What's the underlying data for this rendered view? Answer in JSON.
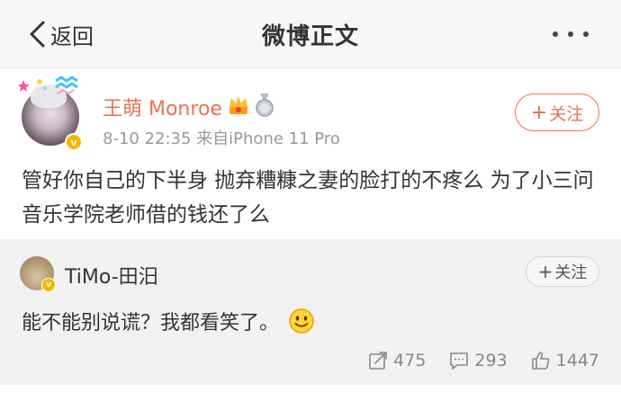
{
  "navbar": {
    "back_label": "返回",
    "title": "微博正文"
  },
  "post": {
    "author": "王萌 Monroe",
    "meta": "8-10 22:35  来自iPhone 11 Pro",
    "follow_label": "关注",
    "text": "管好你自己的下半身 抛弃糟糠之妻的脸打的不疼么  为了小三问音乐学院老师借的钱还了么"
  },
  "repost": {
    "author": "TiMo-田汨",
    "follow_label": "关注",
    "text": "能不能别说谎？我都看笑了。",
    "stats": {
      "reposts": "475",
      "comments": "293",
      "likes": "1447"
    }
  },
  "colors": {
    "accent": "#eb7350",
    "verified": "#f7b500"
  },
  "icons": [
    "back-chevron-icon",
    "more-dots-icon",
    "crown-icon",
    "medal-icon",
    "verified-icon",
    "smile-emoji-icon",
    "repost-icon",
    "comment-icon",
    "like-icon"
  ]
}
